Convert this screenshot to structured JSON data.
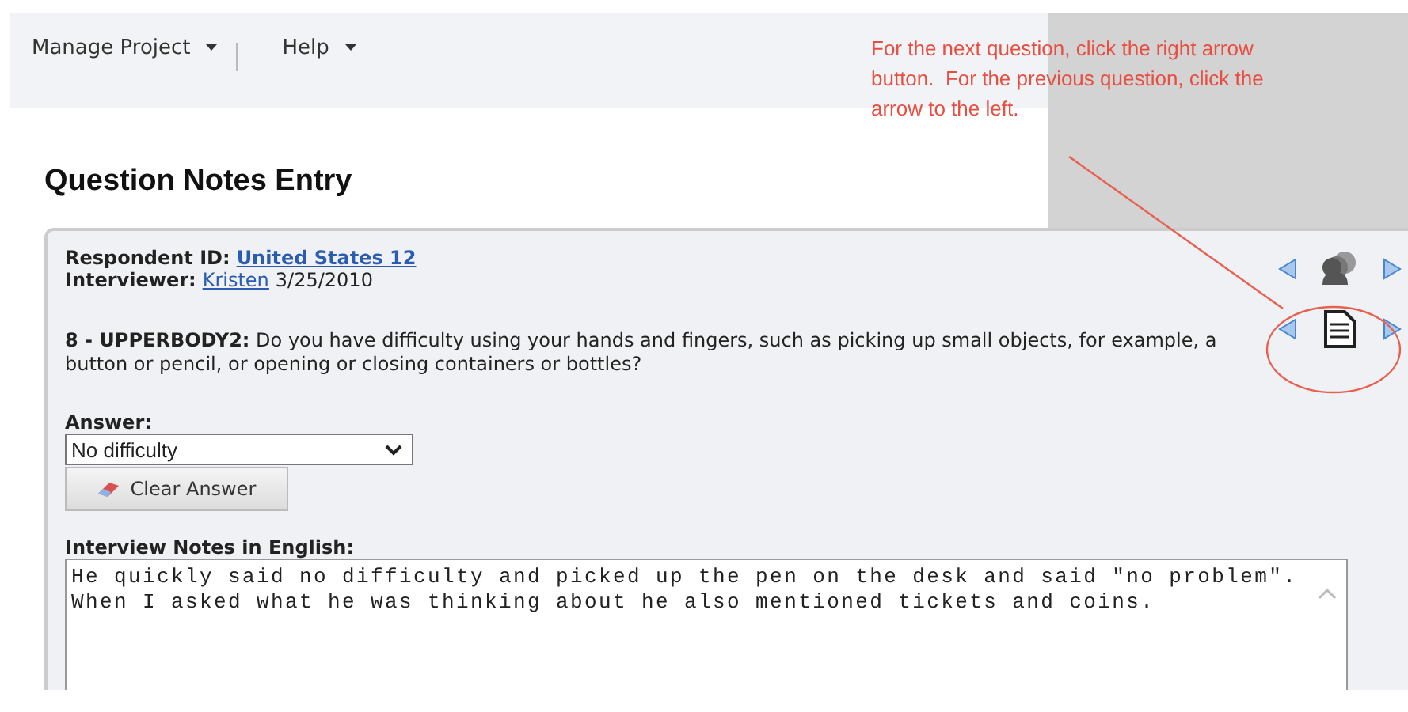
{
  "menu": [
    {
      "label": "Manage Project"
    },
    {
      "label": "Help"
    }
  ],
  "annotation": {
    "text": "For the next question, click the right arrow button.  For the previous question, click the arrow to the left."
  },
  "title": "Question Notes Entry",
  "respondent": {
    "label": "Respondent ID:",
    "value": "United States 12"
  },
  "interviewer": {
    "label": "Interviewer:",
    "name": "Kristen",
    "date": "3/25/2010"
  },
  "question": {
    "text": "**8 - UPPERBODY2:** Do you have difficulty using your hands and fingers, such as picking up small objects, for example, a button or pencil, or opening or closing containers or bottles?"
  },
  "answer": {
    "label": "Answer:",
    "value": "No difficulty"
  },
  "clear_button": {
    "label": "Clear Answer"
  },
  "notes": {
    "label": "Interview Notes in English:",
    "value": "He quickly said no difficulty and picked up the pen on the desk and said \"no problem\".  When I asked what he was thinking about he also mentioned tickets and coins."
  }
}
